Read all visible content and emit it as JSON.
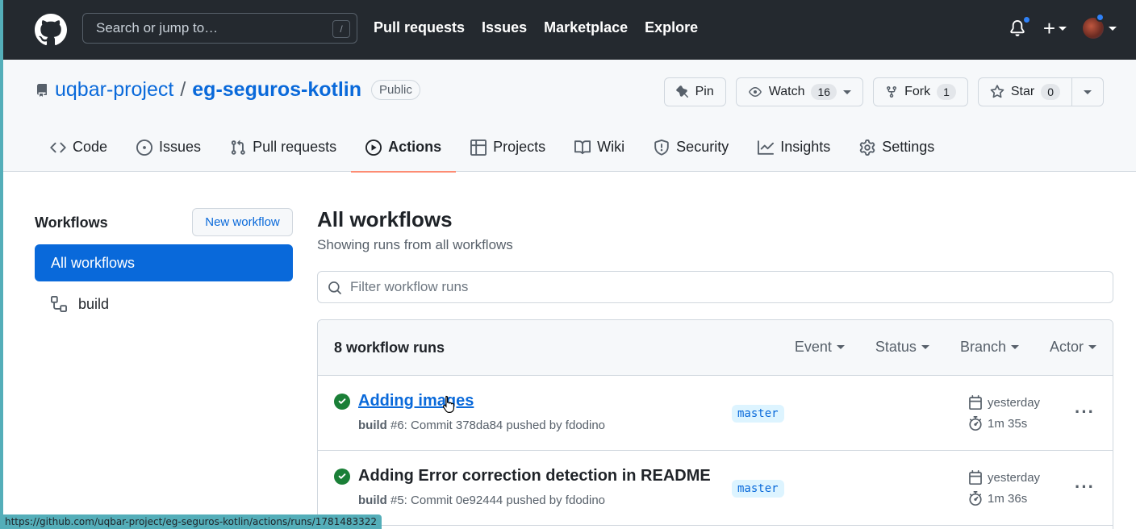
{
  "header": {
    "search_placeholder": "Search or jump to…",
    "search_shortcut": "/",
    "nav": [
      "Pull requests",
      "Issues",
      "Marketplace",
      "Explore"
    ],
    "icons": [
      "github-logo-icon",
      "bell-icon",
      "plus-icon",
      "avatar"
    ]
  },
  "repo": {
    "owner": "uqbar-project",
    "separator": "/",
    "name": "eg-seguros-kotlin",
    "visibility": "Public",
    "buttons": {
      "pin": "Pin",
      "watch": "Watch",
      "watch_count": "16",
      "fork": "Fork",
      "fork_count": "1",
      "star": "Star",
      "star_count": "0"
    },
    "tabs": [
      "Code",
      "Issues",
      "Pull requests",
      "Actions",
      "Projects",
      "Wiki",
      "Security",
      "Insights",
      "Settings"
    ],
    "active_tab": "Actions"
  },
  "sidebar": {
    "title": "Workflows",
    "new_workflow": "New workflow",
    "items": [
      {
        "label": "All workflows",
        "active": true
      },
      {
        "label": "build",
        "active": false
      }
    ]
  },
  "main": {
    "title": "All workflows",
    "subtitle": "Showing runs from all workflows",
    "filter_placeholder": "Filter workflow runs",
    "runs_count": "8 workflow runs",
    "filters": [
      "Event",
      "Status",
      "Branch",
      "Actor"
    ],
    "runs": [
      {
        "title": "Adding images",
        "workflow": "build",
        "meta": "#6: Commit 378da84 pushed by fdodino",
        "branch": "master",
        "when": "yesterday",
        "duration": "1m 35s"
      },
      {
        "title": "Adding Error correction detection in README",
        "workflow": "build",
        "meta": "#5: Commit 0e92444 pushed by fdodino",
        "branch": "master",
        "when": "yesterday",
        "duration": "1m 36s"
      }
    ]
  },
  "statusbar": {
    "url": "https://github.com/uqbar-project/eg-seguros-kotlin/actions/runs/1781483322"
  },
  "colors": {
    "header_bg": "#24292f",
    "accent": "#0969da",
    "success": "#1a7f37",
    "tab_underline": "#fd8c73"
  }
}
